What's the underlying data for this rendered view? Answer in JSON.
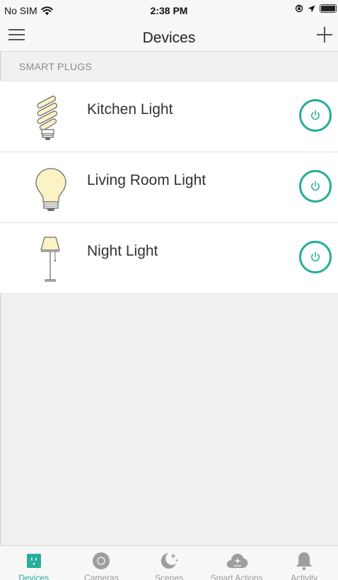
{
  "status_bar": {
    "carrier": "No SIM",
    "time": "2:38 PM"
  },
  "nav": {
    "title": "Devices"
  },
  "section": {
    "title": "SMART PLUGS"
  },
  "devices": [
    {
      "name": "Kitchen Light",
      "icon": "cfl-bulb-icon",
      "power": "off"
    },
    {
      "name": "Living Room Light",
      "icon": "light-bulb-icon",
      "power": "off"
    },
    {
      "name": "Night Light",
      "icon": "floor-lamp-icon",
      "power": "off"
    }
  ],
  "tabs": [
    {
      "label": "Devices",
      "icon": "smart-plug-icon",
      "active": true
    },
    {
      "label": "Cameras",
      "icon": "camera-icon",
      "active": false
    },
    {
      "label": "Scenes",
      "icon": "moon-icon",
      "active": false
    },
    {
      "label": "Smart Actions",
      "icon": "cloud-icon",
      "active": false
    },
    {
      "label": "Activity",
      "icon": "bell-icon",
      "active": false
    }
  ],
  "colors": {
    "accent": "#27ad98",
    "background": "#f2f1f0",
    "bulb_fill": "#fbf3c4",
    "tab_icon_inactive": "#9e9e9e"
  }
}
